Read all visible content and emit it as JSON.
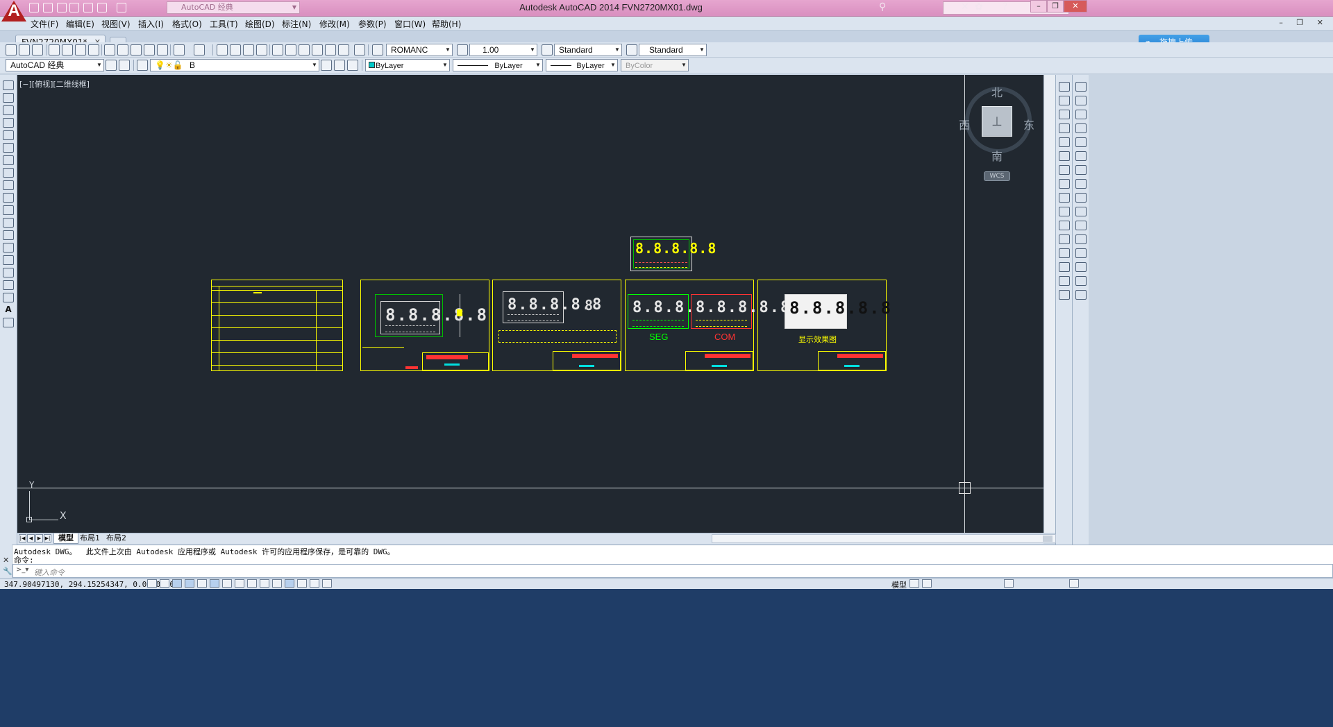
{
  "app": {
    "title": "Autodesk AutoCAD 2014    FVN2720MX01.dwg",
    "workspace": "AutoCAD 经典",
    "logo_letter": "A"
  },
  "menu": [
    "文件(F)",
    "编辑(E)",
    "视图(V)",
    "插入(I)",
    "格式(O)",
    "工具(T)",
    "绘图(D)",
    "标注(N)",
    "修改(M)",
    "参数(P)",
    "窗口(W)",
    "帮助(H)"
  ],
  "tabs": {
    "doc_tab": "FVN2720MX01*",
    "upload_button": "拖拽上传"
  },
  "toolbar1": {
    "text_style": "ROMANC",
    "text_height": "1.00",
    "dim_style": "Standard",
    "table_style": "Standard"
  },
  "toolbar2": {
    "workspace": "AutoCAD 经典",
    "layer": "B",
    "color": "ByLayer",
    "linetype": "ByLayer",
    "lineweight": "ByLayer",
    "plotstyle": "ByColor"
  },
  "viewport": {
    "label": "[−][俯视][二维线框]"
  },
  "drawing": {
    "lcd_digits": "8.8.8.8.8",
    "seg_label": "SEG",
    "com_label": "COM",
    "display_label": "显示效果图",
    "colors": {
      "frame": "#ffff00",
      "seg": "#00ff00",
      "com": "#ff3333",
      "background": "#212830"
    }
  },
  "viewcube": {
    "north": "北",
    "south": "南",
    "east": "东",
    "west": "西",
    "wcs": "WCS"
  },
  "ucs": {
    "x": "X",
    "y": "Y"
  },
  "layout_tabs": [
    "模型",
    "布局1",
    "布局2"
  ],
  "command": {
    "history_line": "Autodesk DWG。  此文件上次由 Autodesk 应用程序或 Autodesk 许可的应用程序保存，是可靠的 DWG。",
    "prompt_line": "命令:",
    "input_placeholder": "键入命令"
  },
  "status": {
    "coords": "347.90497130, 294.15254347, 0.00000000",
    "model_label": "模型"
  }
}
